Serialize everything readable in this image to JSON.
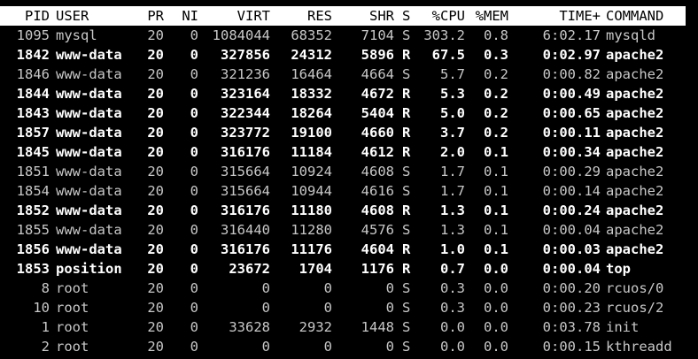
{
  "columns": {
    "pid": "PID",
    "user": "USER",
    "pr": "PR",
    "ni": "NI",
    "virt": "VIRT",
    "res": "RES",
    "shr": "SHR",
    "s": "S",
    "cpu": "%CPU",
    "mem": "%MEM",
    "time": "TIME+",
    "command": "COMMAND"
  },
  "processes": [
    {
      "pid": "1095",
      "user": "mysql",
      "pr": "20",
      "ni": "0",
      "virt": "1084044",
      "res": "68352",
      "shr": "7104",
      "s": "S",
      "cpu": "303.2",
      "mem": "0.8",
      "time": "6:02.17",
      "command": "mysqld",
      "bold": false
    },
    {
      "pid": "1842",
      "user": "www-data",
      "pr": "20",
      "ni": "0",
      "virt": "327856",
      "res": "24312",
      "shr": "5896",
      "s": "R",
      "cpu": "67.5",
      "mem": "0.3",
      "time": "0:02.97",
      "command": "apache2",
      "bold": true
    },
    {
      "pid": "1846",
      "user": "www-data",
      "pr": "20",
      "ni": "0",
      "virt": "321236",
      "res": "16464",
      "shr": "4664",
      "s": "S",
      "cpu": "5.7",
      "mem": "0.2",
      "time": "0:00.82",
      "command": "apache2",
      "bold": false
    },
    {
      "pid": "1844",
      "user": "www-data",
      "pr": "20",
      "ni": "0",
      "virt": "323164",
      "res": "18332",
      "shr": "4672",
      "s": "R",
      "cpu": "5.3",
      "mem": "0.2",
      "time": "0:00.49",
      "command": "apache2",
      "bold": true
    },
    {
      "pid": "1843",
      "user": "www-data",
      "pr": "20",
      "ni": "0",
      "virt": "322344",
      "res": "18264",
      "shr": "5404",
      "s": "R",
      "cpu": "5.0",
      "mem": "0.2",
      "time": "0:00.65",
      "command": "apache2",
      "bold": true
    },
    {
      "pid": "1857",
      "user": "www-data",
      "pr": "20",
      "ni": "0",
      "virt": "323772",
      "res": "19100",
      "shr": "4660",
      "s": "R",
      "cpu": "3.7",
      "mem": "0.2",
      "time": "0:00.11",
      "command": "apache2",
      "bold": true
    },
    {
      "pid": "1845",
      "user": "www-data",
      "pr": "20",
      "ni": "0",
      "virt": "316176",
      "res": "11184",
      "shr": "4612",
      "s": "R",
      "cpu": "2.0",
      "mem": "0.1",
      "time": "0:00.34",
      "command": "apache2",
      "bold": true
    },
    {
      "pid": "1851",
      "user": "www-data",
      "pr": "20",
      "ni": "0",
      "virt": "315664",
      "res": "10924",
      "shr": "4608",
      "s": "S",
      "cpu": "1.7",
      "mem": "0.1",
      "time": "0:00.29",
      "command": "apache2",
      "bold": false
    },
    {
      "pid": "1854",
      "user": "www-data",
      "pr": "20",
      "ni": "0",
      "virt": "315664",
      "res": "10944",
      "shr": "4616",
      "s": "S",
      "cpu": "1.7",
      "mem": "0.1",
      "time": "0:00.14",
      "command": "apache2",
      "bold": false
    },
    {
      "pid": "1852",
      "user": "www-data",
      "pr": "20",
      "ni": "0",
      "virt": "316176",
      "res": "11180",
      "shr": "4608",
      "s": "R",
      "cpu": "1.3",
      "mem": "0.1",
      "time": "0:00.24",
      "command": "apache2",
      "bold": true
    },
    {
      "pid": "1855",
      "user": "www-data",
      "pr": "20",
      "ni": "0",
      "virt": "316440",
      "res": "11280",
      "shr": "4576",
      "s": "S",
      "cpu": "1.3",
      "mem": "0.1",
      "time": "0:00.04",
      "command": "apache2",
      "bold": false
    },
    {
      "pid": "1856",
      "user": "www-data",
      "pr": "20",
      "ni": "0",
      "virt": "316176",
      "res": "11176",
      "shr": "4604",
      "s": "R",
      "cpu": "1.0",
      "mem": "0.1",
      "time": "0:00.03",
      "command": "apache2",
      "bold": true
    },
    {
      "pid": "1853",
      "user": "position",
      "pr": "20",
      "ni": "0",
      "virt": "23672",
      "res": "1704",
      "shr": "1176",
      "s": "R",
      "cpu": "0.7",
      "mem": "0.0",
      "time": "0:00.04",
      "command": "top",
      "bold": true
    },
    {
      "pid": "8",
      "user": "root",
      "pr": "20",
      "ni": "0",
      "virt": "0",
      "res": "0",
      "shr": "0",
      "s": "S",
      "cpu": "0.3",
      "mem": "0.0",
      "time": "0:00.20",
      "command": "rcuos/0",
      "bold": false
    },
    {
      "pid": "10",
      "user": "root",
      "pr": "20",
      "ni": "0",
      "virt": "0",
      "res": "0",
      "shr": "0",
      "s": "S",
      "cpu": "0.3",
      "mem": "0.0",
      "time": "0:00.23",
      "command": "rcuos/2",
      "bold": false
    },
    {
      "pid": "1",
      "user": "root",
      "pr": "20",
      "ni": "0",
      "virt": "33628",
      "res": "2932",
      "shr": "1448",
      "s": "S",
      "cpu": "0.0",
      "mem": "0.0",
      "time": "0:03.78",
      "command": "init",
      "bold": false
    },
    {
      "pid": "2",
      "user": "root",
      "pr": "20",
      "ni": "0",
      "virt": "0",
      "res": "0",
      "shr": "0",
      "s": "S",
      "cpu": "0.0",
      "mem": "0.0",
      "time": "0:00.15",
      "command": "kthreadd",
      "bold": false
    }
  ]
}
